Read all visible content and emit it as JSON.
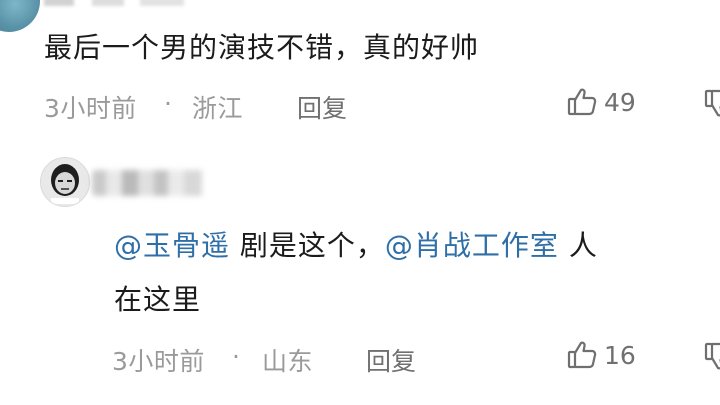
{
  "first_comment": {
    "text": "最后一个男的演技不错，真的好帅",
    "time": "3小时前",
    "separator": "·",
    "location": "浙江",
    "reply_label": "回复",
    "likes": "49"
  },
  "reply": {
    "mention1": "@玉骨遥",
    "text1": " 剧是这个，",
    "mention2": "@肖战工作室",
    "text2": " 人",
    "line2": "在这里",
    "time": "3小时前",
    "separator": "·",
    "location": "山东",
    "reply_label": "回复",
    "likes": "16"
  },
  "icons": {
    "like": "thumbs-up-icon",
    "dislike": "thumbs-down-icon"
  },
  "colors": {
    "mention": "#2f6fa8",
    "text": "#1b1b1b",
    "meta": "#9a9a9a"
  }
}
